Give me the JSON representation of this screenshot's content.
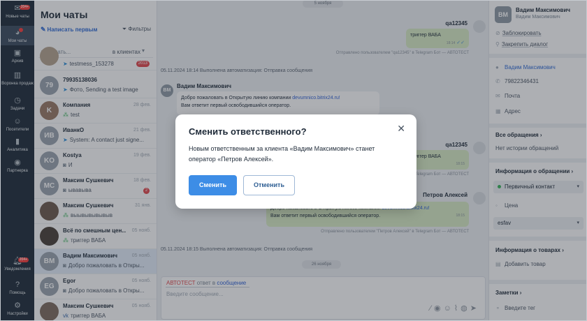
{
  "nav": {
    "items": [
      {
        "label": "Новые чаты",
        "badge": "204+",
        "icon": "new-chats-icon"
      },
      {
        "label": "Мои чаты",
        "icon": "my-chats-icon"
      },
      {
        "label": "Архив",
        "icon": "archive-icon"
      },
      {
        "label": "Воронка продаж",
        "icon": "funnel-icon"
      },
      {
        "label": "Задачи",
        "icon": "tasks-icon"
      },
      {
        "label": "Посетители",
        "icon": "visitors-icon"
      },
      {
        "label": "Аналитика",
        "icon": "analytics-icon"
      },
      {
        "label": "Партнерка",
        "icon": "partner-icon"
      },
      {
        "label": "Уведомления",
        "badge": "204+",
        "icon": "bell-icon"
      },
      {
        "label": "Помощь",
        "icon": "help-icon"
      },
      {
        "label": "Настройки",
        "icon": "settings-icon"
      }
    ]
  },
  "list": {
    "title": "Мои чаты",
    "write_first": "Написать первым",
    "filters": "Фильтры",
    "search_placeholder": "Искать...",
    "search_scope": "в клиентах",
    "chats": [
      {
        "name": "",
        "preview": "testmess_153278",
        "date": "",
        "counter": "2013",
        "avatar": "",
        "channel": "telegram"
      },
      {
        "name": "79935138036",
        "preview": "Фото, Sending a test image",
        "date": "",
        "avatar": "79",
        "channel": "telegram"
      },
      {
        "name": "Компания",
        "preview": "test",
        "date": "28 фев.",
        "avatar": "K",
        "channel": "multi"
      },
      {
        "name": "ИванкО",
        "preview": "System: A contact just signe...",
        "date": "21 фев.",
        "avatar": "ИВ",
        "channel": "telegram"
      },
      {
        "name": "Kostya",
        "preview": "И",
        "date": "19 фев.",
        "avatar": "KO",
        "channel": "bot"
      },
      {
        "name": "Максим Сушкевич",
        "preview": "ывавыва",
        "date": "18 фев.",
        "avatar": "МС",
        "channel": "multi",
        "counter": "2"
      },
      {
        "name": "Максим Сушкевич",
        "preview": "выывывывывыв",
        "date": "31 янв.",
        "avatar": "",
        "channel": "multi"
      },
      {
        "name": "Всё по смешным цен...",
        "preview": "триггер ВАБА",
        "date": "05 нояб.",
        "avatar": "",
        "channel": "multi"
      },
      {
        "name": "Вадим Максимович",
        "preview": "Добро пожаловать в Откры...",
        "date": "05 нояб.",
        "avatar": "ВМ",
        "channel": "bot"
      },
      {
        "name": "Egor",
        "preview": "Добро пожаловать в Откры...",
        "date": "05 нояб.",
        "avatar": "EG",
        "channel": "bot"
      },
      {
        "name": "Максим Сушкевич",
        "preview": "триггер ВАБА",
        "date": "05 нояб.",
        "avatar": "",
        "channel": "vk"
      }
    ]
  },
  "chat": {
    "date_top": "5 ноября",
    "msg1": {
      "sender": "qa12345",
      "text": "триггер ВАБА",
      "time": "18:14",
      "note": "Отправлено пользователем \"qa12345\" в Telegram Бот — АВТОТЕСТ"
    },
    "sys1": "05.11.2024 18:14  Выполнена автоматизация: Отправка сообщения",
    "msg2": {
      "sender": "Вадим Максимович",
      "avatar": "ВМ",
      "text_prefix": "Добро пожаловать в Открытую линию компании ",
      "link": "devumnico.bitrix24.ru!",
      "text_suffix": "Вам ответит первый освободившийся оператор.",
      "time": "18:14"
    },
    "msg3": {
      "sender": "qa12345",
      "text": "триггер ВАБА",
      "time": "18:15",
      "note": "Отправлено пользователем \"qa12345\" в Telegram Бот — АВТОТЕСТ"
    },
    "msg4": {
      "sender": "Петров Алексей",
      "text_prefix": "Добро пожаловать в Открытую линию компании ",
      "link": "devumnico.bitrix24.ru!",
      "text_suffix": "Вам ответит первый освободившийся оператор.",
      "time": "18:15",
      "note": "Отправлено пользователем \"Петров Алексей\" в Telegram Бот — АВТОТЕСТ"
    },
    "sys2": "05.11.2024 18:15  Выполнена автоматизация: Отправка сообщения",
    "date_bottom": "26 ноября",
    "composer": {
      "auto": "АВТОТЕСТ",
      "middle": " ответ в ",
      "msg": "сообщение",
      "placeholder": "Введите сообщение..."
    }
  },
  "side": {
    "avatar": "ВМ",
    "name": "Вадим Максимович",
    "sub": "Вадим Максимович",
    "block": "Заблокировать",
    "pin": "Закрепить диалог",
    "contact_name": "Вадим Максимович",
    "phone": "79822346431",
    "email": "Почта",
    "address": "Адрес",
    "all_requests": "Все обращения",
    "no_history": "Нет истории обращений",
    "request_info": "Информация о обращении",
    "stage": "Первичный контакт",
    "price": "Цена",
    "field_value": "esfav",
    "goods_info": "Информация о товарах",
    "add_goods": "Добавить товар",
    "notes": "Заметки",
    "tag_placeholder": "Введите тег"
  },
  "modal": {
    "title": "Сменить ответственного?",
    "body": "Новым ответственным за клиента «Вадим Максимович» станет оператор «Петров Алексей».",
    "confirm": "Сменить",
    "cancel": "Отменить"
  }
}
